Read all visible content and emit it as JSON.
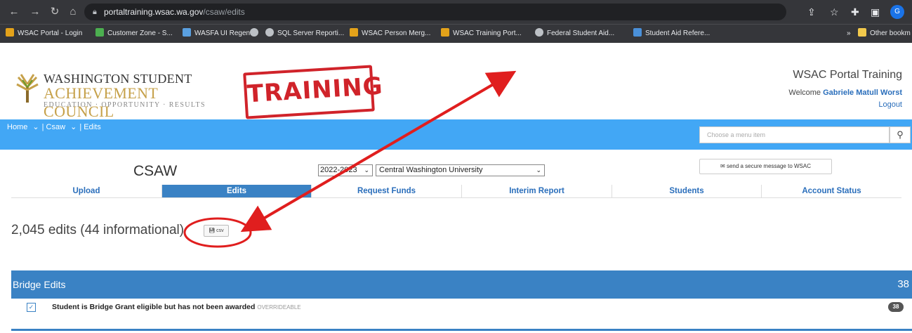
{
  "browser": {
    "host": "portaltraining.wsac.wa.gov",
    "path": "/csaw/edits",
    "profile_initial": "G",
    "bookmarks": [
      {
        "label": "WSAC Portal - Login",
        "icon": "wsac-icon",
        "color": "#e3a21a"
      },
      {
        "label": "Customer Zone - S...",
        "icon": "customer-zone-icon",
        "color": "#4caf50"
      },
      {
        "label": "WASFA UI Regent",
        "icon": "wasfa-icon",
        "color": "#5aa0e0"
      },
      {
        "label": "",
        "icon": "globe-icon",
        "color": "#bdc1c6"
      },
      {
        "label": "SQL Server Reporti...",
        "icon": "globe-icon",
        "color": "#bdc1c6"
      },
      {
        "label": "WSAC Person Merg...",
        "icon": "wsac-icon",
        "color": "#e3a21a"
      },
      {
        "label": "WSAC Training Port...",
        "icon": "wsac-icon",
        "color": "#e3a21a"
      },
      {
        "label": "Federal Student Aid...",
        "icon": "globe-icon",
        "color": "#bdc1c6"
      },
      {
        "label": "Student Aid Refere...",
        "icon": "doc-icon",
        "color": "#4a90d9"
      }
    ],
    "other_bookmarks": "Other bookm",
    "overflow": "»"
  },
  "header": {
    "logo_line1": "WASHINGTON STUDENT",
    "logo_line2": "ACHIEVEMENT COUNCIL",
    "logo_line3": "EDUCATION · OPPORTUNITY · RESULTS",
    "stamp": "TRAINING",
    "portal_title": "WSAC Portal Training",
    "welcome": "Welcome",
    "user_name": "Gabriele Matull Worst",
    "logout": "Logout"
  },
  "nav": {
    "home": "Home",
    "csaw": "Csaw",
    "edits": "Edits",
    "search_placeholder": "Choose a menu item"
  },
  "csaw": {
    "title": "CSAW",
    "year": "2022-2023",
    "school": "Central Washington University",
    "secure_message": "send a secure message to WSAC"
  },
  "tabs": [
    "Upload",
    "Edits",
    "Request Funds",
    "Interim Report",
    "Students",
    "Account Status"
  ],
  "summary": {
    "count_text": "2,045 edits (44 informational)",
    "csv_label": "csv"
  },
  "bridge": {
    "title": "Bridge Edits",
    "count": "38",
    "rows": [
      {
        "text": "Student is Bridge Grant eligible but has not been awarded",
        "tag": "OVERRIDEABLE",
        "badge": "38"
      }
    ]
  },
  "colors": {
    "nav_blue": "#42a7f5",
    "section_blue": "#3a82c4",
    "annotation_red": "#e01e1e"
  }
}
